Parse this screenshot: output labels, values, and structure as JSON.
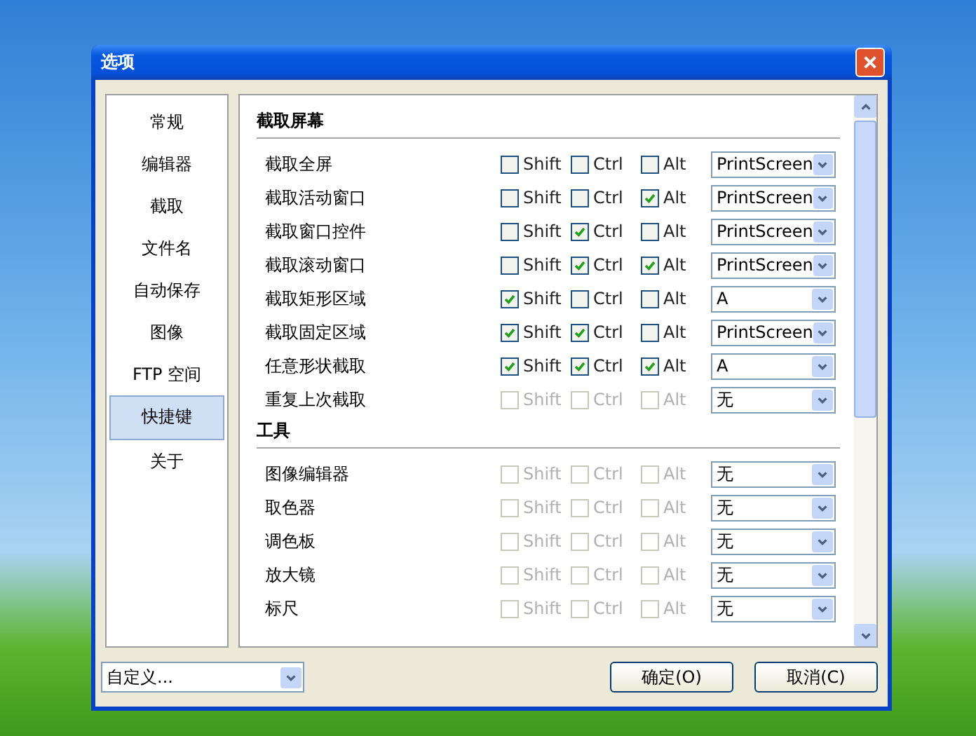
{
  "window": {
    "title": "选项"
  },
  "sidebar": {
    "items": [
      {
        "label": "常规",
        "selected": false
      },
      {
        "label": "编辑器",
        "selected": false
      },
      {
        "label": "截取",
        "selected": false
      },
      {
        "label": "文件名",
        "selected": false
      },
      {
        "label": "自动保存",
        "selected": false
      },
      {
        "label": "图像",
        "selected": false
      },
      {
        "label": "FTP 空间",
        "selected": false
      },
      {
        "label": "快捷键",
        "selected": true
      },
      {
        "label": "关于",
        "selected": false
      }
    ]
  },
  "sections": [
    {
      "title": "截取屏幕",
      "rows": [
        {
          "label": "截取全屏",
          "disabled": false,
          "modifiers": [
            {
              "label": "Shift",
              "checked": false
            },
            {
              "label": "Ctrl",
              "checked": false
            },
            {
              "label": "Alt",
              "checked": false
            }
          ],
          "key": "PrintScreen"
        },
        {
          "label": "截取活动窗口",
          "disabled": false,
          "modifiers": [
            {
              "label": "Shift",
              "checked": false
            },
            {
              "label": "Ctrl",
              "checked": false
            },
            {
              "label": "Alt",
              "checked": true
            }
          ],
          "key": "PrintScreen"
        },
        {
          "label": "截取窗口控件",
          "disabled": false,
          "modifiers": [
            {
              "label": "Shift",
              "checked": false
            },
            {
              "label": "Ctrl",
              "checked": true
            },
            {
              "label": "Alt",
              "checked": false
            }
          ],
          "key": "PrintScreen"
        },
        {
          "label": "截取滚动窗口",
          "disabled": false,
          "modifiers": [
            {
              "label": "Shift",
              "checked": false
            },
            {
              "label": "Ctrl",
              "checked": true
            },
            {
              "label": "Alt",
              "checked": true
            }
          ],
          "key": "PrintScreen"
        },
        {
          "label": "截取矩形区域",
          "disabled": false,
          "modifiers": [
            {
              "label": "Shift",
              "checked": true
            },
            {
              "label": "Ctrl",
              "checked": false
            },
            {
              "label": "Alt",
              "checked": false
            }
          ],
          "key": "A"
        },
        {
          "label": "截取固定区域",
          "disabled": false,
          "modifiers": [
            {
              "label": "Shift",
              "checked": true
            },
            {
              "label": "Ctrl",
              "checked": true
            },
            {
              "label": "Alt",
              "checked": false
            }
          ],
          "key": "PrintScreen"
        },
        {
          "label": "任意形状截取",
          "disabled": false,
          "modifiers": [
            {
              "label": "Shift",
              "checked": true
            },
            {
              "label": "Ctrl",
              "checked": true
            },
            {
              "label": "Alt",
              "checked": true
            }
          ],
          "key": "A"
        },
        {
          "label": "重复上次截取",
          "disabled": true,
          "modifiers": [
            {
              "label": "Shift",
              "checked": false
            },
            {
              "label": "Ctrl",
              "checked": false
            },
            {
              "label": "Alt",
              "checked": false
            }
          ],
          "key": "无"
        }
      ]
    },
    {
      "title": "工具",
      "rows": [
        {
          "label": "图像编辑器",
          "disabled": true,
          "modifiers": [
            {
              "label": "Shift",
              "checked": false
            },
            {
              "label": "Ctrl",
              "checked": false
            },
            {
              "label": "Alt",
              "checked": false
            }
          ],
          "key": "无"
        },
        {
          "label": "取色器",
          "disabled": true,
          "modifiers": [
            {
              "label": "Shift",
              "checked": false
            },
            {
              "label": "Ctrl",
              "checked": false
            },
            {
              "label": "Alt",
              "checked": false
            }
          ],
          "key": "无"
        },
        {
          "label": "调色板",
          "disabled": true,
          "modifiers": [
            {
              "label": "Shift",
              "checked": false
            },
            {
              "label": "Ctrl",
              "checked": false
            },
            {
              "label": "Alt",
              "checked": false
            }
          ],
          "key": "无"
        },
        {
          "label": "放大镜",
          "disabled": true,
          "modifiers": [
            {
              "label": "Shift",
              "checked": false
            },
            {
              "label": "Ctrl",
              "checked": false
            },
            {
              "label": "Alt",
              "checked": false
            }
          ],
          "key": "无"
        },
        {
          "label": "标尺",
          "disabled": true,
          "modifiers": [
            {
              "label": "Shift",
              "checked": false
            },
            {
              "label": "Ctrl",
              "checked": false
            },
            {
              "label": "Alt",
              "checked": false
            }
          ],
          "key": "无"
        }
      ]
    }
  ],
  "footer": {
    "preset": "自定义...",
    "buttons": [
      "确定(O)",
      "取消(C)"
    ]
  }
}
